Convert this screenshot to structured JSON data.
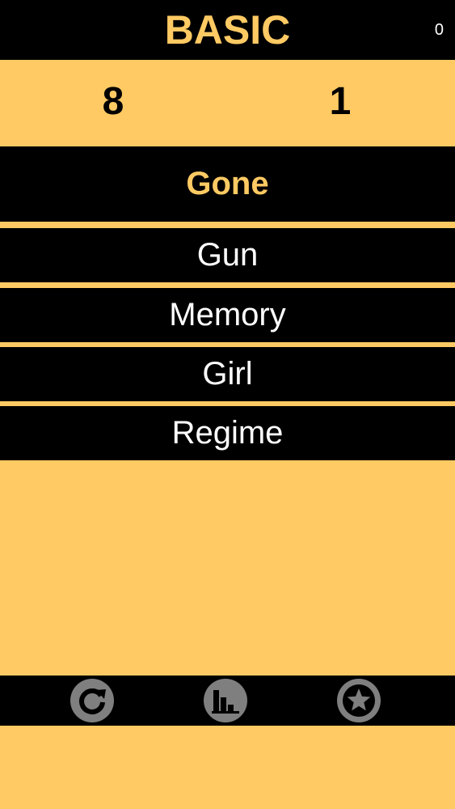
{
  "header": {
    "title": "BASIC",
    "counter": "0"
  },
  "scores": {
    "left": "8",
    "right": "1"
  },
  "target_word": "Gone",
  "options": [
    "Gun",
    "Memory",
    "Girl",
    "Regime"
  ],
  "toolbar": {
    "buttons": [
      "restart-icon",
      "stats-icon",
      "star-icon"
    ]
  },
  "colors": {
    "accent": "#FFCA63",
    "bar": "#000000",
    "text_light": "#FFFFFF",
    "icon": "#7F7F7F"
  }
}
